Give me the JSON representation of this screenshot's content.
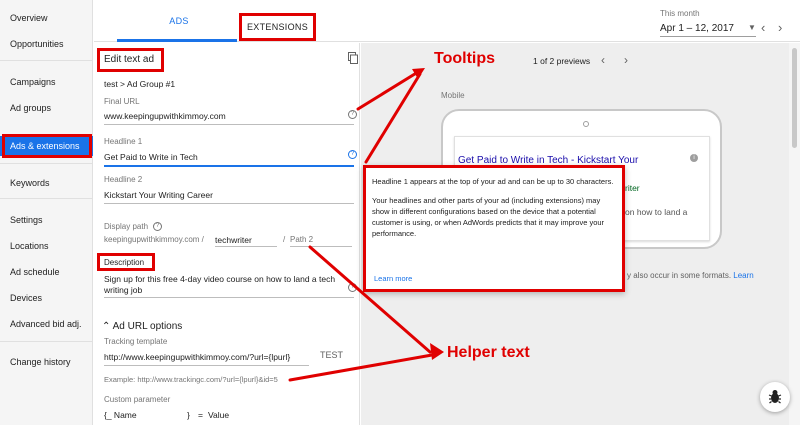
{
  "sidebar": {
    "items": [
      {
        "label": "Overview"
      },
      {
        "label": "Opportunities"
      },
      {
        "label": "Campaigns"
      },
      {
        "label": "Ad groups"
      },
      {
        "label": "Ads & extensions"
      },
      {
        "label": "Keywords"
      },
      {
        "label": "Settings"
      },
      {
        "label": "Locations"
      },
      {
        "label": "Ad schedule"
      },
      {
        "label": "Devices"
      },
      {
        "label": "Advanced bid adj."
      },
      {
        "label": "Change history"
      }
    ]
  },
  "tabs": {
    "ads": "ADS",
    "extensions": "EXTENSIONS"
  },
  "date": {
    "label": "This month",
    "value": "Apr 1 – 12, 2017"
  },
  "editor": {
    "title": "Edit text ad",
    "breadcrumb": "test > Ad Group #1",
    "final_url": {
      "label": "Final URL",
      "value": "www.keepingupwithkimmoy.com"
    },
    "headline1": {
      "label": "Headline 1",
      "value": "Get Paid to Write in Tech"
    },
    "headline2": {
      "label": "Headline 2",
      "value": "Kickstart Your Writing Career"
    },
    "display_path": {
      "label": "Display path",
      "base": "keepingupwithkimmoy.com /",
      "path1": "techwriter",
      "sep": "/",
      "path2_placeholder": "Path 2"
    },
    "description": {
      "label": "Description",
      "line1": "Sign up for this free 4-day video course on how to land a tech",
      "line2": "writing job"
    },
    "url_options": {
      "heading": "Ad URL options",
      "tracking_label": "Tracking template",
      "tracking_value": "http://www.keepingupwithkimmoy.com/?url={lpurl}",
      "test_label": "TEST",
      "example": "Example: http://www.trackingc.com/?url={lpurl}&id=5",
      "custom_label": "Custom parameter",
      "custom_name": "{_ Name",
      "custom_close": "}",
      "custom_eq": "=",
      "custom_value": "Value"
    }
  },
  "preview": {
    "count": "1 of 2 previews",
    "device": "Mobile",
    "ad_headline": "Get Paid to Write in Tech - Kickstart Your",
    "ad_url_fragment": "riter",
    "ad_desc_fragment1": "on how to land a",
    "ad_desc_fragment2": "",
    "note_fragment": "y also occur in some formats.",
    "note_link": "Learn"
  },
  "tooltip": {
    "para1": "Headline 1 appears at the top of your ad and can be up to 30 characters.",
    "para2": "Your headlines and other parts of your ad (including extensions) may show in different configurations based on the device that a potential customer is using, or when AdWords predicts that it may improve your performance.",
    "link": "Learn more"
  },
  "annotations": {
    "tooltips": "Tooltips",
    "helper_text": "Helper text"
  },
  "colors": {
    "accent": "#1a73e8",
    "annotation_red": "#e00000"
  }
}
